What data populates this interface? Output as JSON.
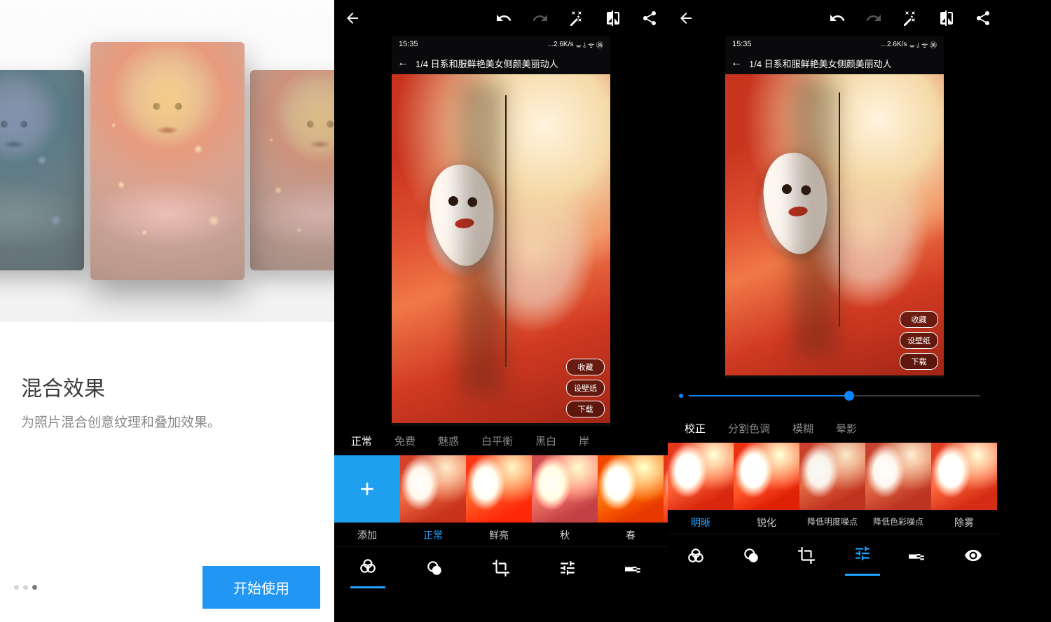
{
  "left": {
    "title": "混合效果",
    "subtitle": "为照片混合创意纹理和叠加效果。",
    "cta": "开始使用",
    "dot_count": 3,
    "active_dot": 2
  },
  "editor_shared": {
    "status_time": "15:35",
    "status_net": "...2.6K/s",
    "status_icons": "ᚚ ⫰ ᯤ ㊱",
    "screenshot_title": "1/4 日系和服鲜艳美女侧颜美丽动人",
    "actions": {
      "fav": "收藏",
      "wallpaper": "设壁纸",
      "download": "下载"
    }
  },
  "mid": {
    "tabs": [
      "正常",
      "免费",
      "魅惑",
      "白平衡",
      "黑白",
      "岸"
    ],
    "active_tab": 0,
    "thumbs": [
      "添加",
      "正常",
      "鲜亮",
      "秋",
      "春"
    ],
    "active_thumb": 1,
    "bottom_active": 0
  },
  "right": {
    "slider_percent": 55,
    "tabs": [
      "校正",
      "分割色调",
      "模糊",
      "晕影"
    ],
    "active_tab": 0,
    "thumbs": [
      "明晰",
      "锐化",
      "降低明度噪点",
      "降低色彩噪点",
      "除雾"
    ],
    "active_thumb": 0,
    "bottom_active": 3
  }
}
